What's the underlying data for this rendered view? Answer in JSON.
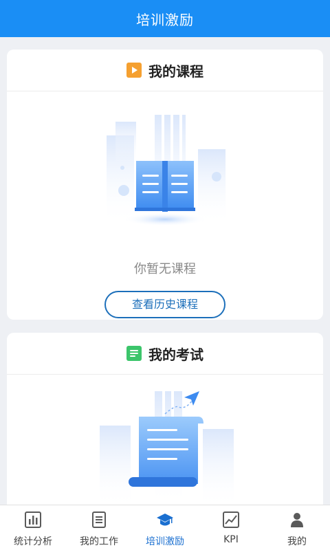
{
  "header": {
    "title": "培训激励"
  },
  "courses": {
    "title": "我的课程",
    "empty_text": "你暂无课程",
    "history_button": "查看历史课程"
  },
  "exams": {
    "title": "我的考试"
  },
  "tabbar": {
    "items": [
      {
        "label": "统计分析",
        "icon": "bar-chart-icon"
      },
      {
        "label": "我的工作",
        "icon": "document-icon"
      },
      {
        "label": "培训激励",
        "icon": "graduation-cap-icon",
        "active": true
      },
      {
        "label": "KPI",
        "icon": "line-chart-icon"
      },
      {
        "label": "我的",
        "icon": "person-icon"
      }
    ]
  },
  "colors": {
    "primary": "#1a8ef5",
    "accent_blue": "#1c6fba",
    "play_icon": "#f5a030",
    "exam_icon": "#3cc56b"
  }
}
